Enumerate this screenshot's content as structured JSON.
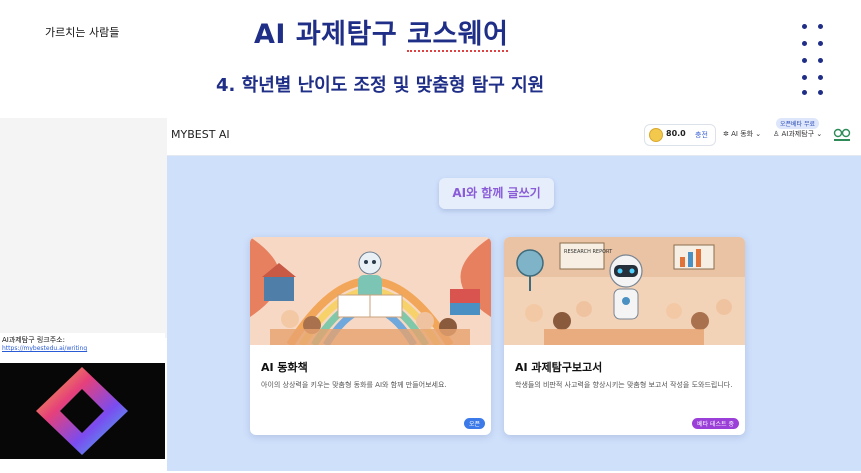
{
  "slide": {
    "corner_label": "가르치는 사람들",
    "title_prefix": "AI 과제탐구 ",
    "title_underlined": "코스웨어",
    "subtitle": "4. 학년별 난이도 조정 및 맞춤형 탐구 지원"
  },
  "app": {
    "brand": "MYBEST AI",
    "points": "80.0",
    "recharge_label": "충전",
    "nav": [
      {
        "label": "AI 동화 ⌄",
        "icon": "sparkle-icon"
      },
      {
        "label": "AI과제탐구 ⌄",
        "icon": "person-icon"
      }
    ],
    "beta_pill": "오픈베타 무료",
    "hero_badge": "AI와 함께 글쓰기",
    "cards": [
      {
        "title": "AI 동화책",
        "description": "아이의 상상력을 키우는 맞춤형 동화를 AI와 함께 만들어보세요.",
        "tag": "오픈"
      },
      {
        "title": "AI 과제탐구보고서",
        "description": "학생들의 비판적 사고력을 향상시키는 맞춤형 보고서 작성을 도와드립니다.",
        "tag": "베타 테스트 중",
        "image_sign": "RESEARCH REPORT"
      }
    ]
  },
  "link_panel": {
    "title": "AI과제탐구 링크주소:",
    "url": "https://mybestedu.ai/writing"
  },
  "colors": {
    "title_navy": "#1f2e86",
    "app_bg": "#cfe0fb",
    "accent_blue": "#3b7ae8",
    "accent_purple": "#9a3fd8"
  }
}
